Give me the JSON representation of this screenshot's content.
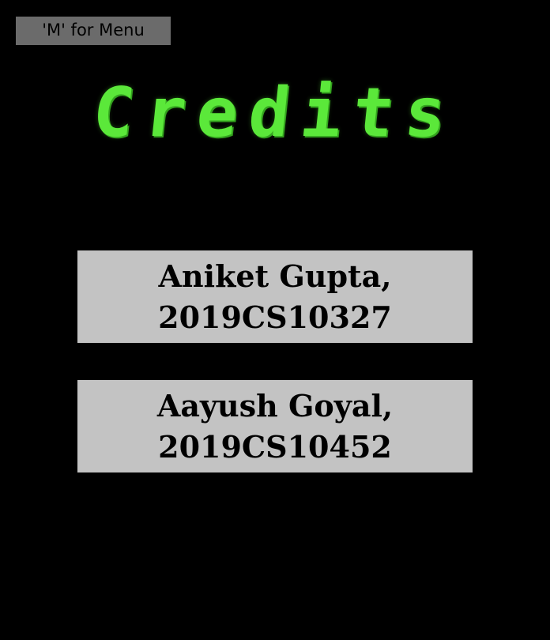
{
  "menu_hint": "'M' for Menu",
  "title": "Credits",
  "credits": [
    {
      "name": "Aniket Gupta,",
      "id": "2019CS10327"
    },
    {
      "name": "Aayush Goyal,",
      "id": "2019CS10452"
    }
  ],
  "colors": {
    "background": "#000000",
    "title": "#5be83a",
    "card": "#c3c3c3",
    "menu_hint_bg": "#6b6b6b"
  }
}
